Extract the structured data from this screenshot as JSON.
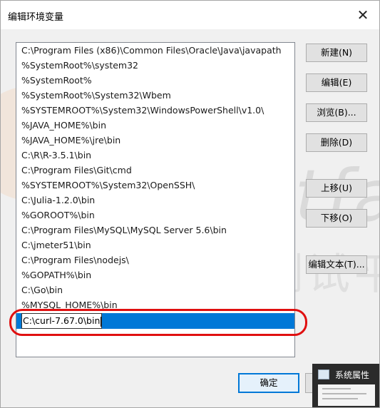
{
  "window": {
    "title": "编辑环境变量",
    "close_glyph": "✕"
  },
  "paths": [
    "C:\\Program Files (x86)\\Common Files\\Oracle\\Java\\javapath",
    "%SystemRoot%\\system32",
    "%SystemRoot%",
    "%SystemRoot%\\System32\\Wbem",
    "%SYSTEMROOT%\\System32\\WindowsPowerShell\\v1.0\\",
    "%JAVA_HOME%\\bin",
    "%JAVA_HOME%\\jre\\bin",
    "C:\\R\\R-3.5.1\\bin",
    "C:\\Program Files\\Git\\cmd",
    "%SYSTEMROOT%\\System32\\OpenSSH\\",
    "C:\\Julia-1.2.0\\bin",
    "%GOROOT%\\bin",
    "C:\\Program Files\\MySQL\\MySQL Server 5.6\\bin",
    "C:\\jmeter51\\bin",
    "C:\\Program Files\\nodejs\\",
    "%GOPATH%\\bin",
    "C:\\Go\\bin",
    "%MYSQL_HOME%\\bin"
  ],
  "editing_value": "C:\\curl-7.67.0\\bin",
  "buttons": {
    "new": "新建(N)",
    "edit": "编辑(E)",
    "browse": "浏览(B)...",
    "delete": "删除(D)",
    "move_up": "上移(U)",
    "move_down": "下移(O)",
    "edit_text": "编辑文本(T)...",
    "ok": "确定"
  },
  "watermark": {
    "text_en": "Testfa",
    "text_cn": "软件测试平"
  },
  "taskbar_thumbnail": {
    "title": "系统属性",
    "icon": "window-icon"
  },
  "colors": {
    "selection": "#0078d7",
    "annotation": "#e01010"
  }
}
